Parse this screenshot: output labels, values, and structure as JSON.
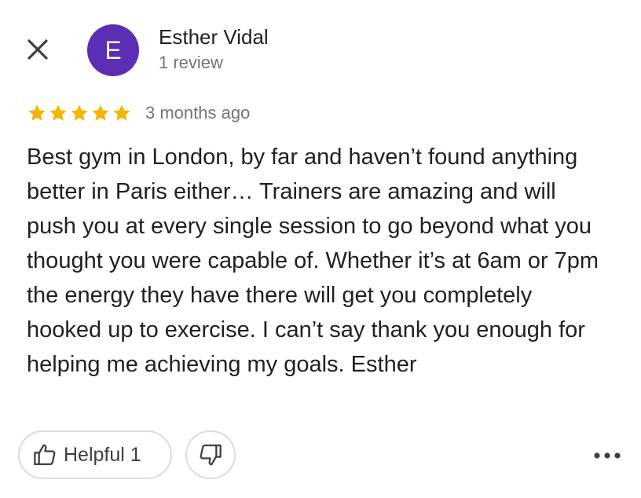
{
  "header": {
    "close_icon": "close-icon",
    "author": {
      "initial": "E",
      "name": "Esther Vidal",
      "review_count": "1 review",
      "avatar_color": "#5b2eb5"
    }
  },
  "review": {
    "rating": 5,
    "max_rating": 5,
    "star_color": "#f4b400",
    "date": "3 months ago",
    "text": "Best gym in London, by far and haven’t found anything better in Paris either… Trainers are amazing and will push you at every single session to go beyond what you thought you were capable of. Whether it’s at 6am or 7pm the energy they have there will get you completely hooked up to exercise. I can’t say thank you enough for helping me achieving my goals. Esther"
  },
  "actions": {
    "helpful_label": "Helpful 1",
    "helpful_icon": "thumbs-up-icon",
    "dislike_icon": "thumbs-down-icon",
    "more_icon": "more-horizontal-icon"
  }
}
